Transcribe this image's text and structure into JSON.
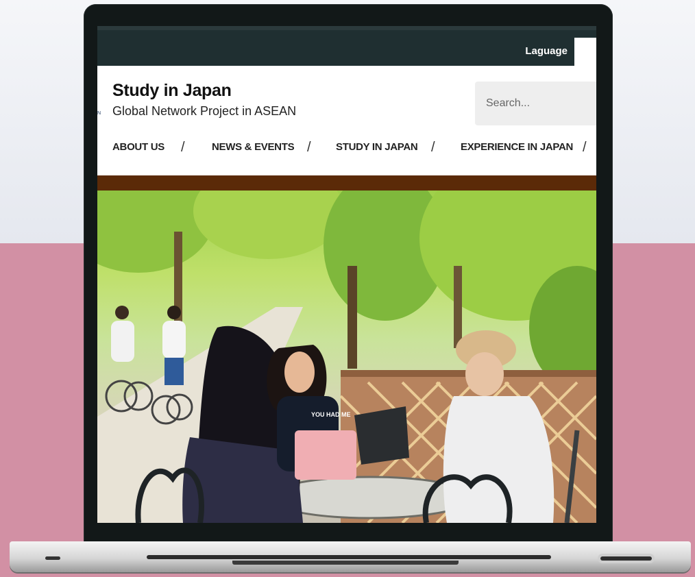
{
  "topbar": {
    "language_label": "Laguage"
  },
  "header": {
    "title": "Study in Japan",
    "subtitle": "Global Network Project in ASEAN",
    "logo_fragment": "N",
    "search": {
      "placeholder": "Search..."
    }
  },
  "nav": {
    "items": [
      {
        "label": "ABOUT US"
      },
      {
        "label": "NEWS & EVENTS"
      },
      {
        "label": "STUDY IN JAPAN"
      },
      {
        "label": "EXPERIENCE IN JAPAN"
      }
    ],
    "separator": "/"
  },
  "hero": {
    "shirt_text": "YOU HAD ME",
    "description_icon": "students-studying-outdoors-photo"
  },
  "colors": {
    "topbar": "#1f2f31",
    "accent_bar": "#5b2a08",
    "backdrop_pink": "#d290a4"
  }
}
